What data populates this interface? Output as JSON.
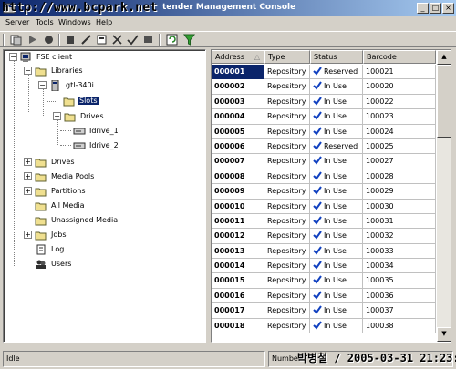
{
  "window": {
    "watermark": "http://www.bcpark.net",
    "title_fragment": "tender Management Console",
    "buttons": {
      "minimize": "_",
      "maximize": "□",
      "close": "×"
    }
  },
  "menu": [
    "Server",
    "Tools",
    "Windows",
    "Help"
  ],
  "toolbar_icons": [
    "connect-icon",
    "play-icon",
    "stop-icon",
    "media-icon",
    "edit-icon",
    "properties-icon",
    "delete-icon",
    "check-icon",
    "load-icon",
    "refresh-icon",
    "filter-icon"
  ],
  "tree": {
    "root": "FSE client",
    "libraries": "Libraries",
    "library": "gtl-340i",
    "slots": "Slots",
    "drives_lib": "Drives",
    "drive1": "Idrive_1",
    "drive2": "Idrive_2",
    "drives": "Drives",
    "media_pools": "Media Pools",
    "partitions": "Partitions",
    "all_media": "All Media",
    "unassigned_media": "Unassigned Media",
    "jobs": "Jobs",
    "log": "Log",
    "users": "Users"
  },
  "table": {
    "columns": [
      "Address",
      "Type",
      "Status",
      "Barcode"
    ],
    "rows": [
      {
        "address": "000001",
        "type": "Repository",
        "status": "Reserved",
        "barcode": "100021"
      },
      {
        "address": "000002",
        "type": "Repository",
        "status": "In Use",
        "barcode": "100020"
      },
      {
        "address": "000003",
        "type": "Repository",
        "status": "In Use",
        "barcode": "100022"
      },
      {
        "address": "000004",
        "type": "Repository",
        "status": "In Use",
        "barcode": "100023"
      },
      {
        "address": "000005",
        "type": "Repository",
        "status": "In Use",
        "barcode": "100024"
      },
      {
        "address": "000006",
        "type": "Repository",
        "status": "Reserved",
        "barcode": "100025"
      },
      {
        "address": "000007",
        "type": "Repository",
        "status": "In Use",
        "barcode": "100027"
      },
      {
        "address": "000008",
        "type": "Repository",
        "status": "In Use",
        "barcode": "100028"
      },
      {
        "address": "000009",
        "type": "Repository",
        "status": "In Use",
        "barcode": "100029"
      },
      {
        "address": "000010",
        "type": "Repository",
        "status": "In Use",
        "barcode": "100030"
      },
      {
        "address": "000011",
        "type": "Repository",
        "status": "In Use",
        "barcode": "100031"
      },
      {
        "address": "000012",
        "type": "Repository",
        "status": "In Use",
        "barcode": "100032"
      },
      {
        "address": "000013",
        "type": "Repository",
        "status": "In Use",
        "barcode": "100033"
      },
      {
        "address": "000014",
        "type": "Repository",
        "status": "In Use",
        "barcode": "100034"
      },
      {
        "address": "000015",
        "type": "Repository",
        "status": "In Use",
        "barcode": "100035"
      },
      {
        "address": "000016",
        "type": "Repository",
        "status": "In Use",
        "barcode": "100036"
      },
      {
        "address": "000017",
        "type": "Repository",
        "status": "In Use",
        "barcode": "100037"
      },
      {
        "address": "000018",
        "type": "Repository",
        "status": "In Use",
        "barcode": "100038"
      }
    ]
  },
  "status": {
    "left": "Idle",
    "right_label": "Number",
    "footer_watermark": "박병철 / 2005-03-31 21:23:13"
  },
  "colors": {
    "selection": "#0a246a",
    "check": "#1040c0",
    "face": "#d4d0c8"
  }
}
